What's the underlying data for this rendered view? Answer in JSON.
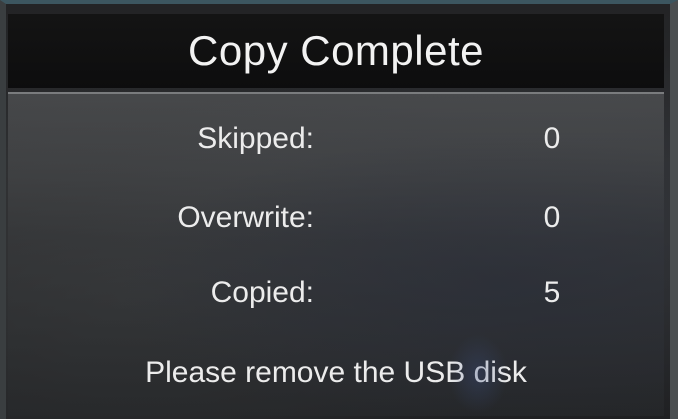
{
  "dialog": {
    "title": "Copy Complete",
    "stats": [
      {
        "label": "Skipped:",
        "value": "0"
      },
      {
        "label": "Overwrite:",
        "value": "0"
      },
      {
        "label": "Copied:",
        "value": "5"
      }
    ],
    "message": "Please remove the USB disk"
  }
}
